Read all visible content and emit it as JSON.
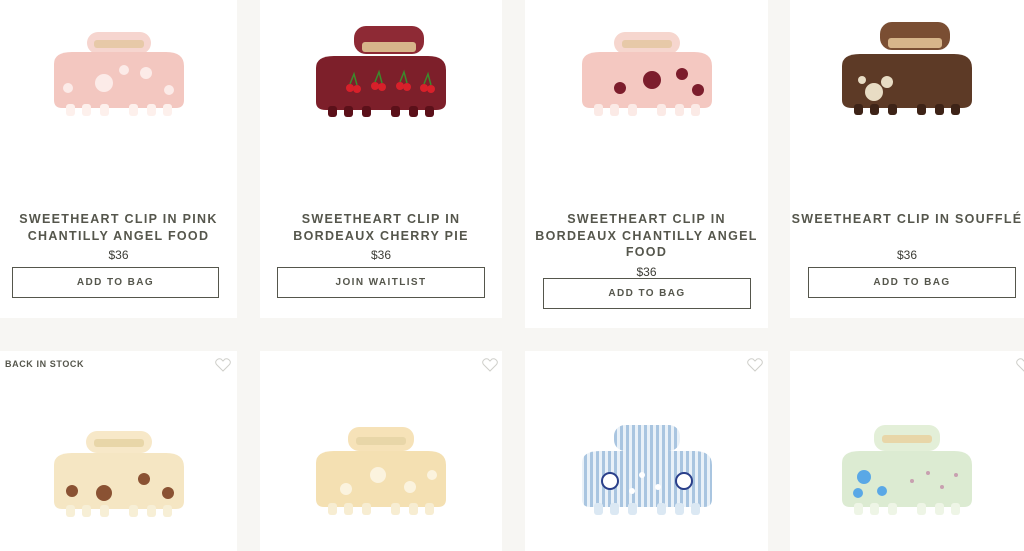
{
  "products": [
    {
      "title": "SWEETHEART CLIP IN PINK CHANTILLY ANGEL FOOD",
      "price": "$36",
      "button": "ADD TO BAG"
    },
    {
      "title": "SWEETHEART CLIP IN BORDEAUX CHERRY PIE",
      "price": "$36",
      "button": "JOIN WAITLIST"
    },
    {
      "title": "SWEETHEART CLIP IN BORDEAUX CHANTILLY ANGEL FOOD",
      "price": "$36",
      "button": "ADD TO BAG"
    },
    {
      "title": "SWEETHEART CLIP IN SOUFFLÉ",
      "price": "$36",
      "button": "ADD TO BAG"
    }
  ],
  "second_row": {
    "badge": "BACK IN STOCK",
    "icons": [
      "heart-icon",
      "heart-icon",
      "heart-icon",
      "heart-icon"
    ]
  }
}
